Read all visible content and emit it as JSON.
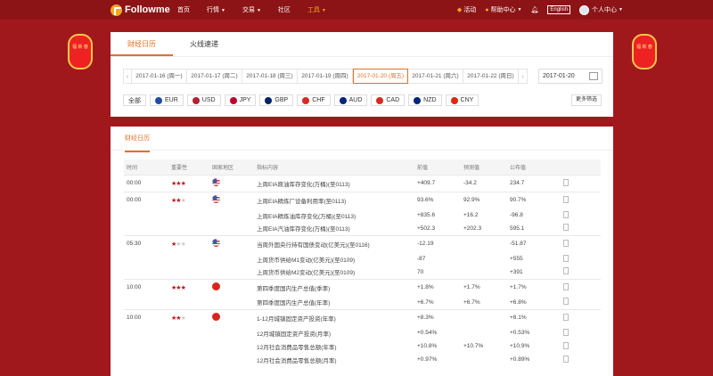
{
  "header": {
    "logo": "Followme",
    "nav": [
      {
        "label": "首页",
        "caret": false,
        "active": false
      },
      {
        "label": "行情",
        "caret": true,
        "active": false
      },
      {
        "label": "交易",
        "caret": true,
        "active": false
      },
      {
        "label": "社区",
        "caret": false,
        "active": false
      },
      {
        "label": "工具",
        "caret": true,
        "active": true
      }
    ],
    "right": {
      "activity": "活动",
      "help": "帮助中心",
      "lang": "English",
      "user": "个人中心"
    }
  },
  "decor": {
    "lantern_text": "福 新 春"
  },
  "top_card": {
    "tabs": [
      "财经日历",
      "火线速递"
    ],
    "dates": [
      "2017-01-16 (周一)",
      "2017-01-17 (周二)",
      "2017-01-18 (周三)",
      "2017-01-19 (周四)",
      "2017-01-20 (周五)",
      "2017-01-21 (周六)",
      "2017-01-22 (周日)"
    ],
    "active_date_index": 4,
    "date_input": "2017-01-20",
    "currencies": [
      {
        "label": "全部",
        "color": ""
      },
      {
        "label": "EUR",
        "color": "#1f4aa8"
      },
      {
        "label": "USD",
        "color": "#b22234"
      },
      {
        "label": "JPY",
        "color": "#bc002d"
      },
      {
        "label": "GBP",
        "color": "#012169"
      },
      {
        "label": "CHF",
        "color": "#d52b1e"
      },
      {
        "label": "AUD",
        "color": "#00247d"
      },
      {
        "label": "CAD",
        "color": "#d52b1e"
      },
      {
        "label": "NZD",
        "color": "#00247d"
      },
      {
        "label": "CNY",
        "color": "#de2910"
      }
    ],
    "more": "更多筛选"
  },
  "news": {
    "tab": "财经日历",
    "columns": [
      "时间",
      "重要性",
      "国家地区",
      "指标内容",
      "前值",
      "预测值",
      "公布值"
    ],
    "rows": [
      {
        "time": "00:00",
        "stars": 3,
        "flag": "us",
        "item": "上周EIA原油库存变化(万桶)(至0113)",
        "prev": "+409.7",
        "fore": "-34.2",
        "actual": "234.7"
      },
      {
        "time": "00:00",
        "stars": 2,
        "flag": "us",
        "item": "上周EIA精炼厂设备利用率(至0113)",
        "prev": "93.6%",
        "fore": "92.9%",
        "actual": "90.7%"
      },
      {
        "time": "",
        "stars": 0,
        "flag": "",
        "item": "上周EIA精炼油库存变化(万桶)(至0113)",
        "prev": "+835.6",
        "fore": "+16.2",
        "actual": "-96.8"
      },
      {
        "time": "",
        "stars": 0,
        "flag": "",
        "item": "上周EIA汽油库存变化(万桶)(至0113)",
        "prev": "+502.3",
        "fore": "+202.3",
        "actual": "595.1"
      },
      {
        "time": "05:30",
        "stars": 1,
        "flag": "us",
        "item": "当周外国央行持有国债变动(亿美元)(至0116)",
        "prev": "-12.19",
        "fore": "",
        "actual": "-51.87"
      },
      {
        "time": "",
        "stars": 0,
        "flag": "",
        "item": "上周货币供给M1变动(亿美元)(至0109)",
        "prev": "-87",
        "fore": "",
        "actual": "+555"
      },
      {
        "time": "",
        "stars": 0,
        "flag": "",
        "item": "上周货币供给M2变动(亿美元)(至0109)",
        "prev": "70",
        "fore": "",
        "actual": "+391"
      },
      {
        "time": "10:00",
        "stars": 3,
        "flag": "cn",
        "item": "第四季度国内生产总值(季率)",
        "prev": "+1.8%",
        "fore": "+1.7%",
        "actual": "+1.7%"
      },
      {
        "time": "",
        "stars": 0,
        "flag": "",
        "item": "第四季度国内生产总值(年率)",
        "prev": "+6.7%",
        "fore": "+6.7%",
        "actual": "+6.8%"
      },
      {
        "time": "10:00",
        "stars": 2,
        "flag": "cn",
        "item": "1-12月城镇固定资产投资(年率)",
        "prev": "+8.3%",
        "fore": "",
        "actual": "+8.1%"
      },
      {
        "time": "",
        "stars": 0,
        "flag": "",
        "item": "12月城镇固定资产投资(月率)",
        "prev": "+0.54%",
        "fore": "",
        "actual": "+0.53%"
      },
      {
        "time": "",
        "stars": 0,
        "flag": "",
        "item": "12月社会消费品零售总额(年率)",
        "prev": "+10.8%",
        "fore": "+10.7%",
        "actual": "+10.9%"
      },
      {
        "time": "",
        "stars": 0,
        "flag": "",
        "item": "12月社会消费品零售总额(月率)",
        "prev": "+0.97%",
        "fore": "",
        "actual": "+0.89%"
      }
    ]
  }
}
